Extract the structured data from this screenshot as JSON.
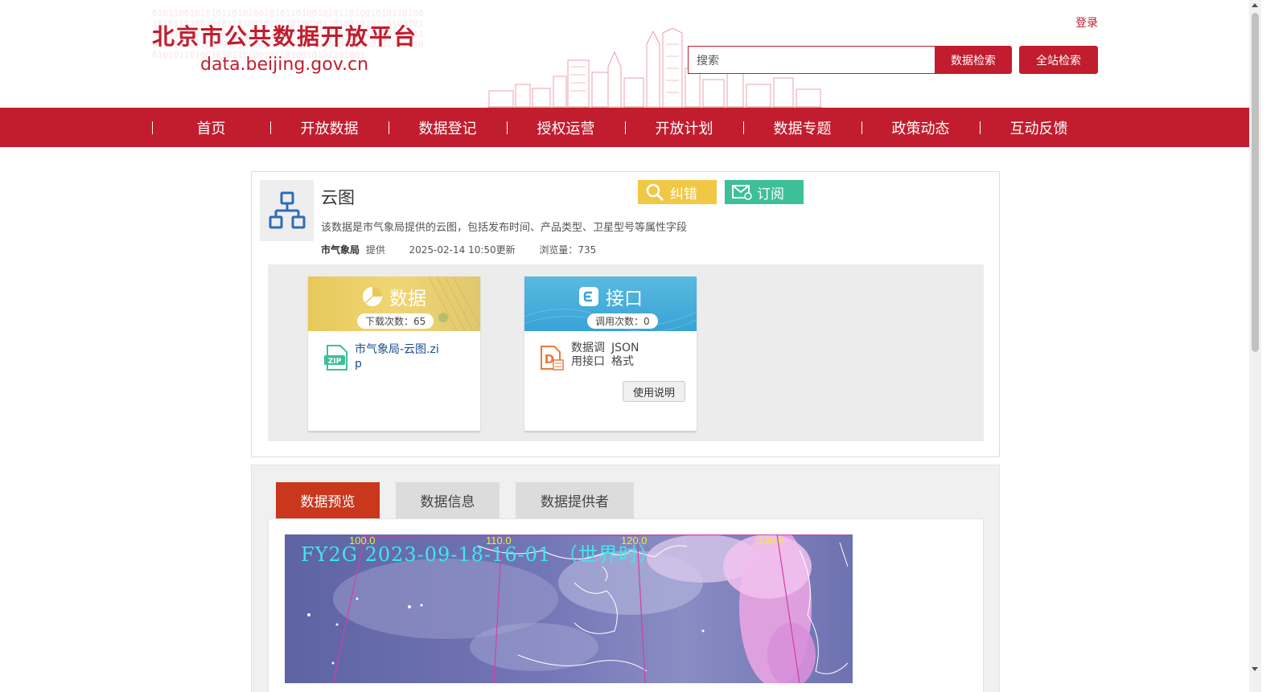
{
  "header": {
    "logo_title": "北京市公共数据开放平台",
    "logo_url": "data.beijing.gov.cn",
    "login_label": "登录",
    "search_placeholder": "搜索",
    "data_search_label": "数据检索",
    "site_search_label": "全站检索"
  },
  "nav": {
    "items": [
      {
        "label": "首页"
      },
      {
        "label": "开放数据"
      },
      {
        "label": "数据登记"
      },
      {
        "label": "授权运营"
      },
      {
        "label": "开放计划"
      },
      {
        "label": "数据专题"
      },
      {
        "label": "政策动态"
      },
      {
        "label": "互动反馈"
      }
    ]
  },
  "dataset": {
    "title": "云图",
    "correct_label": "纠错",
    "subscribe_label": "订阅",
    "description": "该数据是市气象局提供的云图，包括发布时间、产品类型、卫星型号等属性字段",
    "provider": "市气象局",
    "provider_suffix": "提供",
    "updated": "2025-02-14 10:50更新",
    "views": "浏览量：735"
  },
  "resources": {
    "data_card": {
      "title": "数据",
      "badge": "下载次数：65",
      "file_name": "市气象局-云图.zip",
      "file_type_icon": "zip-icon"
    },
    "api_card": {
      "title": "接口",
      "badge": "调用次数：0",
      "label_left": "数据调用接口",
      "label_right": "JSON格式",
      "usage_button": "使用说明"
    }
  },
  "tabs": [
    {
      "label": "数据预览",
      "active": true
    },
    {
      "label": "数据信息",
      "active": false
    },
    {
      "label": "数据提供者",
      "active": false
    }
  ],
  "preview": {
    "caption": "FY2G   2023-09-18-16-01  （世界时）",
    "longitudes": [
      "100.0",
      "110.0",
      "120.0",
      "130.0"
    ]
  },
  "colors": {
    "brand_red": "#c11d2e",
    "correct_yellow": "#f0c846",
    "subscribe_green": "#3dbf9a",
    "active_tab": "#c9371c"
  }
}
